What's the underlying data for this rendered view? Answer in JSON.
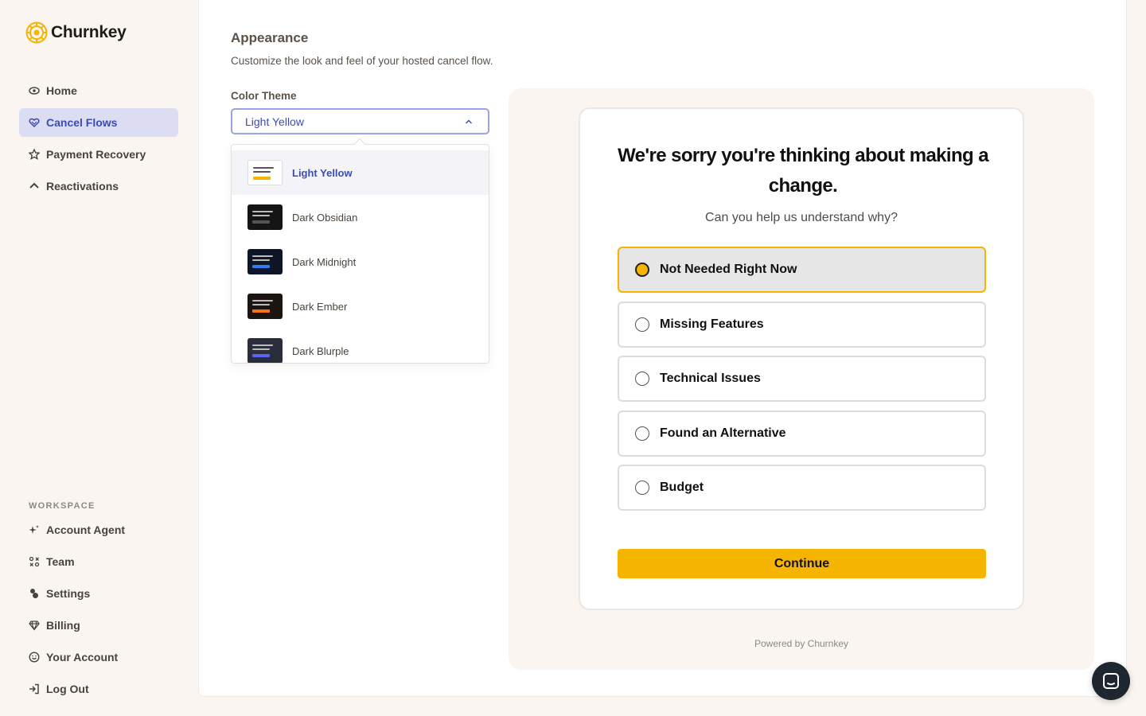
{
  "brand": {
    "name": "Churnkey",
    "color": "#f4b400"
  },
  "sidebar": {
    "items": [
      {
        "label": "Home",
        "icon": "eye-icon"
      },
      {
        "label": "Cancel Flows",
        "icon": "heart-icon",
        "active": true
      },
      {
        "label": "Payment Recovery",
        "icon": "star-icon"
      },
      {
        "label": "Reactivations",
        "icon": "arrow-up-icon"
      }
    ],
    "workspace_label": "WORKSPACE",
    "workspace_items": [
      {
        "label": "Account Agent",
        "icon": "sparkle-icon"
      },
      {
        "label": "Team",
        "icon": "team-icon"
      },
      {
        "label": "Settings",
        "icon": "settings-icon"
      },
      {
        "label": "Billing",
        "icon": "gem-icon"
      },
      {
        "label": "Your Account",
        "icon": "smile-icon"
      },
      {
        "label": "Log Out",
        "icon": "logout-icon"
      }
    ]
  },
  "appearance": {
    "title": "Appearance",
    "description": "Customize the look and feel of your hosted cancel flow.",
    "color_theme_label": "Color Theme",
    "selected_theme": "Light Yellow",
    "themes": [
      {
        "label": "Light Yellow",
        "bg": "#ffffff",
        "line": "#555555",
        "accent": "#f4b400",
        "selected": true
      },
      {
        "label": "Dark Obsidian",
        "bg": "#141414",
        "line": "#bbbbbb",
        "accent": "#555555"
      },
      {
        "label": "Dark Midnight",
        "bg": "#0d1526",
        "line": "#bbbbbb",
        "accent": "#2f7cf6"
      },
      {
        "label": "Dark Ember",
        "bg": "#1c1410",
        "line": "#bbbbbb",
        "accent": "#f97316"
      },
      {
        "label": "Dark Blurple",
        "bg": "#2b2d3a",
        "line": "#bbbbbb",
        "accent": "#5865f2"
      }
    ]
  },
  "preview": {
    "title": "We're sorry you're thinking about making a change.",
    "subtitle": "Can you help us understand why?",
    "reasons": [
      {
        "label": "Not Needed Right Now",
        "selected": true
      },
      {
        "label": "Missing Features"
      },
      {
        "label": "Technical Issues"
      },
      {
        "label": "Found an Alternative"
      },
      {
        "label": "Budget"
      }
    ],
    "continue_label": "Continue",
    "powered_by": "Powered by Churnkey"
  }
}
